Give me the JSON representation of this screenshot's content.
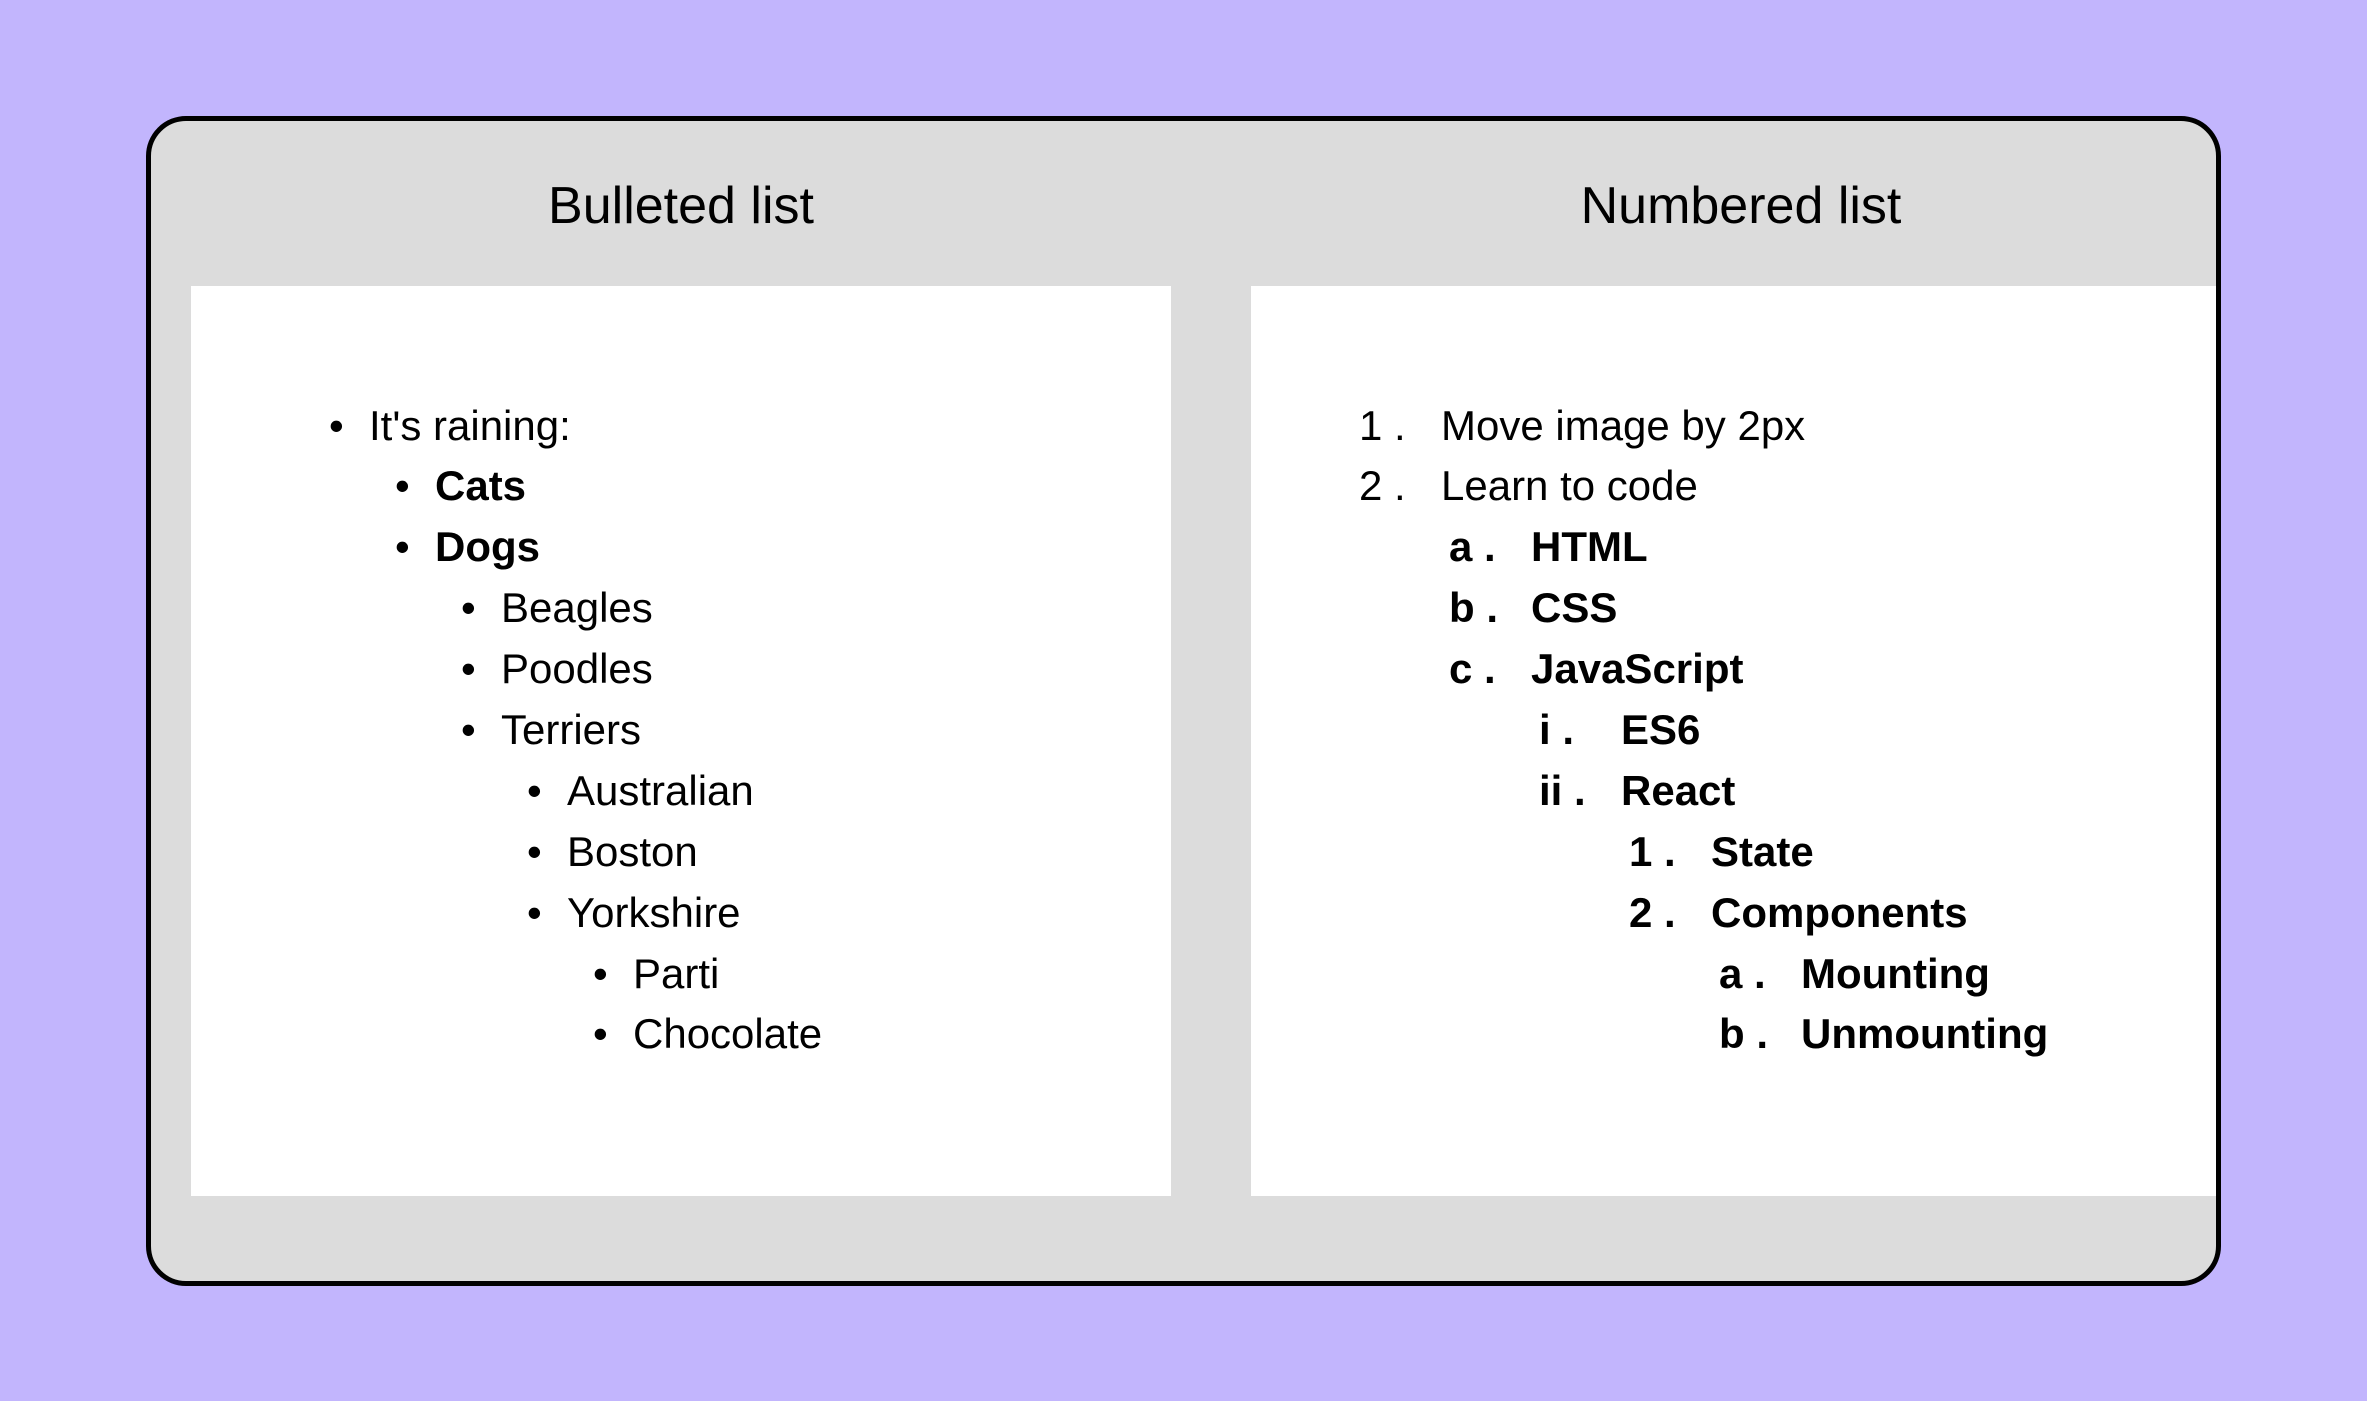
{
  "left": {
    "heading": "Bulleted list",
    "root": {
      "text": "It's raining:",
      "children": [
        {
          "text": "Cats",
          "bold": true
        },
        {
          "text": "Dogs",
          "bold": true,
          "children": [
            {
              "text": "Beagles"
            },
            {
              "text": "Poodles"
            },
            {
              "text": "Terriers",
              "children": [
                {
                  "text": "Australian"
                },
                {
                  "text": "Boston"
                },
                {
                  "text": "Yorkshire",
                  "children": [
                    {
                      "text": "Parti"
                    },
                    {
                      "text": "Chocolate"
                    }
                  ]
                }
              ]
            }
          ]
        }
      ]
    }
  },
  "right": {
    "heading": "Numbered list",
    "items": [
      {
        "text": "Move image by 2px"
      },
      {
        "text": "Learn to code",
        "children_style": "alpha",
        "children": [
          {
            "text": "HTML",
            "bold": true
          },
          {
            "text": "CSS",
            "bold": true
          },
          {
            "text": "JavaScript",
            "bold": true,
            "children_style": "roman",
            "children": [
              {
                "text": "ES6"
              },
              {
                "text": "React",
                "children_style": "dec",
                "children": [
                  {
                    "text": "State"
                  },
                  {
                    "text": "Components",
                    "children_style": "alpha",
                    "children": [
                      {
                        "text": "Mounting"
                      },
                      {
                        "text": "Unmounting"
                      }
                    ]
                  }
                ]
              }
            ]
          }
        ]
      }
    ]
  }
}
